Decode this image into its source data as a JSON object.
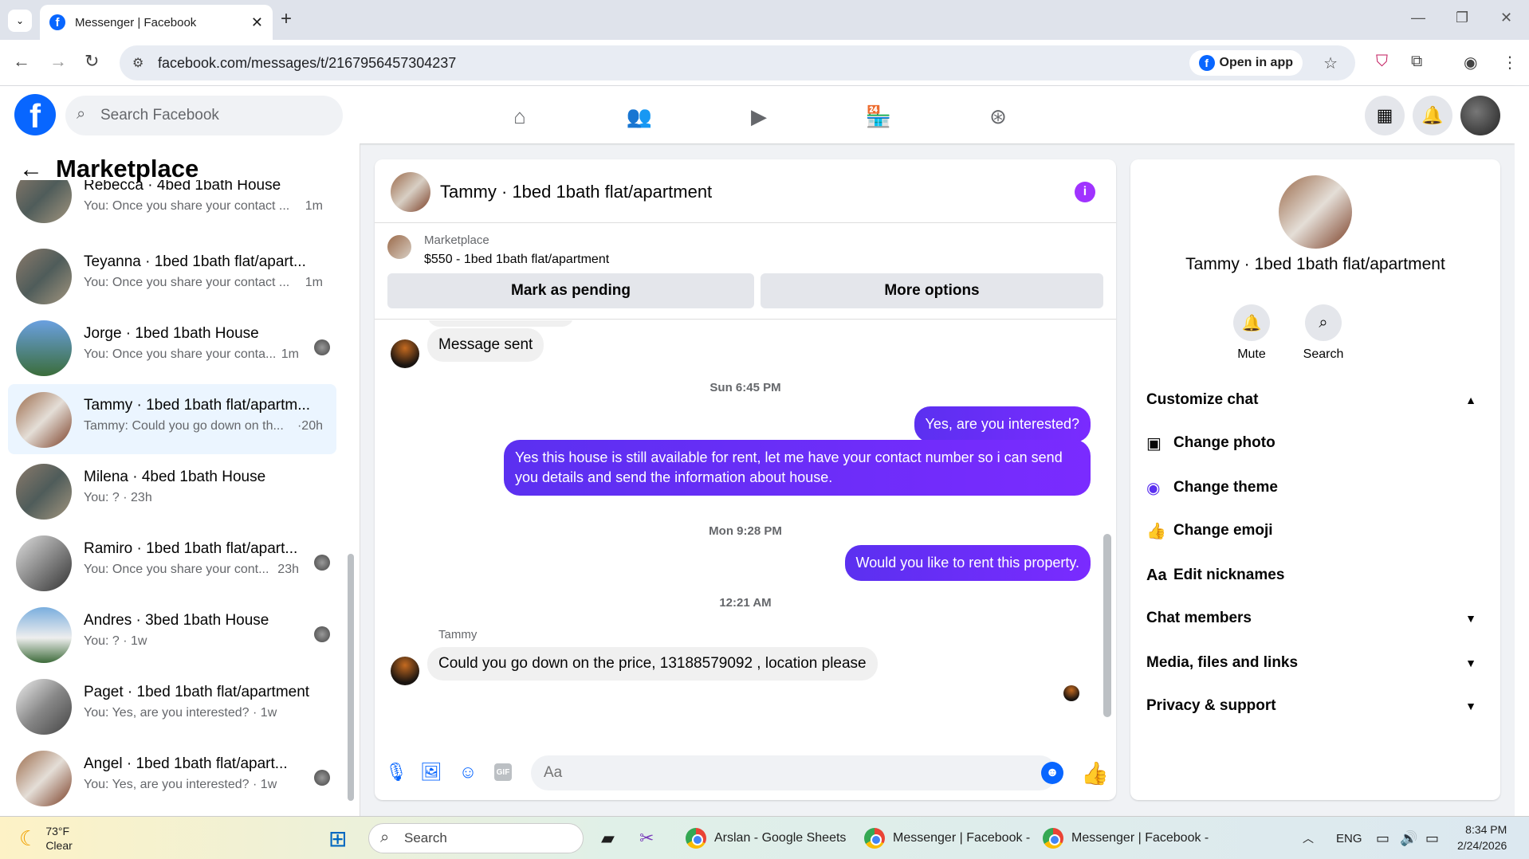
{
  "browser": {
    "tab_title": "Messenger | Facebook",
    "url": "facebook.com/messages/t/2167956457304237",
    "open_in_app": "Open in app"
  },
  "fb_header": {
    "search_placeholder": "Search Facebook"
  },
  "sidebar": {
    "title": "Marketplace",
    "conversations": [
      {
        "name": "Rebecca · 4bed 1bath House",
        "preview": "You: Once you share your contact ...",
        "time": "1m"
      },
      {
        "name": "Teyanna · 1bed 1bath flat/apart...",
        "preview": "You: Once you share your contact ...",
        "time": "1m"
      },
      {
        "name": "Jorge · 1bed 1bath House",
        "preview": "You: Once you share your conta...",
        "time": "1m"
      },
      {
        "name": "Tammy · 1bed 1bath flat/apartm...",
        "preview": "Tammy: Could you go down on th...",
        "time": "·20h"
      },
      {
        "name": "Milena · 4bed 1bath House",
        "preview": "You: ? ·",
        "time": "23h"
      },
      {
        "name": "Ramiro · 1bed 1bath flat/apart...",
        "preview": "You: Once you share your cont...",
        "time": "23h"
      },
      {
        "name": "Andres · 3bed 1bath House",
        "preview": "You: ? ·",
        "time": "1w"
      },
      {
        "name": "Paget · 1bed 1bath flat/apartment",
        "preview": "You: Yes, are you interested? ·",
        "time": "1w"
      },
      {
        "name": "Angel · 1bed 1bath flat/apart...",
        "preview": "You: Yes, are you interested? ·",
        "time": "1w"
      }
    ]
  },
  "chat": {
    "title": "Tammy · 1bed 1bath flat/apartment",
    "listing_label": "Marketplace",
    "listing_price": "$550 - 1bed 1bath flat/apartment",
    "mark_pending": "Mark as pending",
    "more_options": "More options",
    "messages": {
      "m1": "Message sent",
      "t1": "Sun 6:45 PM",
      "m2": "Yes, are you interested?",
      "m3": "Yes this house is still available for rent, let me have your contact number so i can send you details and send the information about house.",
      "t2": "Mon 9:28 PM",
      "m4": "Would you like to rent this property.",
      "t3": "12:21 AM",
      "sender": "Tammy",
      "m5": "Could you go down on the price, 13188579092 , location please"
    },
    "composer_placeholder": "Aa"
  },
  "right_panel": {
    "name": "Tammy · 1bed 1bath flat/apartment",
    "mute": "Mute",
    "search": "Search",
    "customize": "Customize chat",
    "change_photo": "Change photo",
    "change_theme": "Change theme",
    "change_emoji": "Change emoji",
    "edit_nicknames": "Edit nicknames",
    "chat_members": "Chat members",
    "media": "Media, files and links",
    "privacy": "Privacy & support"
  },
  "taskbar": {
    "temp": "73°F",
    "weather": "Clear",
    "search": "Search",
    "app1": "Arslan - Google Sheets",
    "app2": "Messenger | Facebook -",
    "app3": "Messenger | Facebook -",
    "lang": "ENG",
    "time": "8:34 PM",
    "date": "2/24/2026"
  },
  "colors": {
    "fb_blue": "#0866ff",
    "bubble_purple": "#6a2bff",
    "info_purple": "#a033ff"
  }
}
